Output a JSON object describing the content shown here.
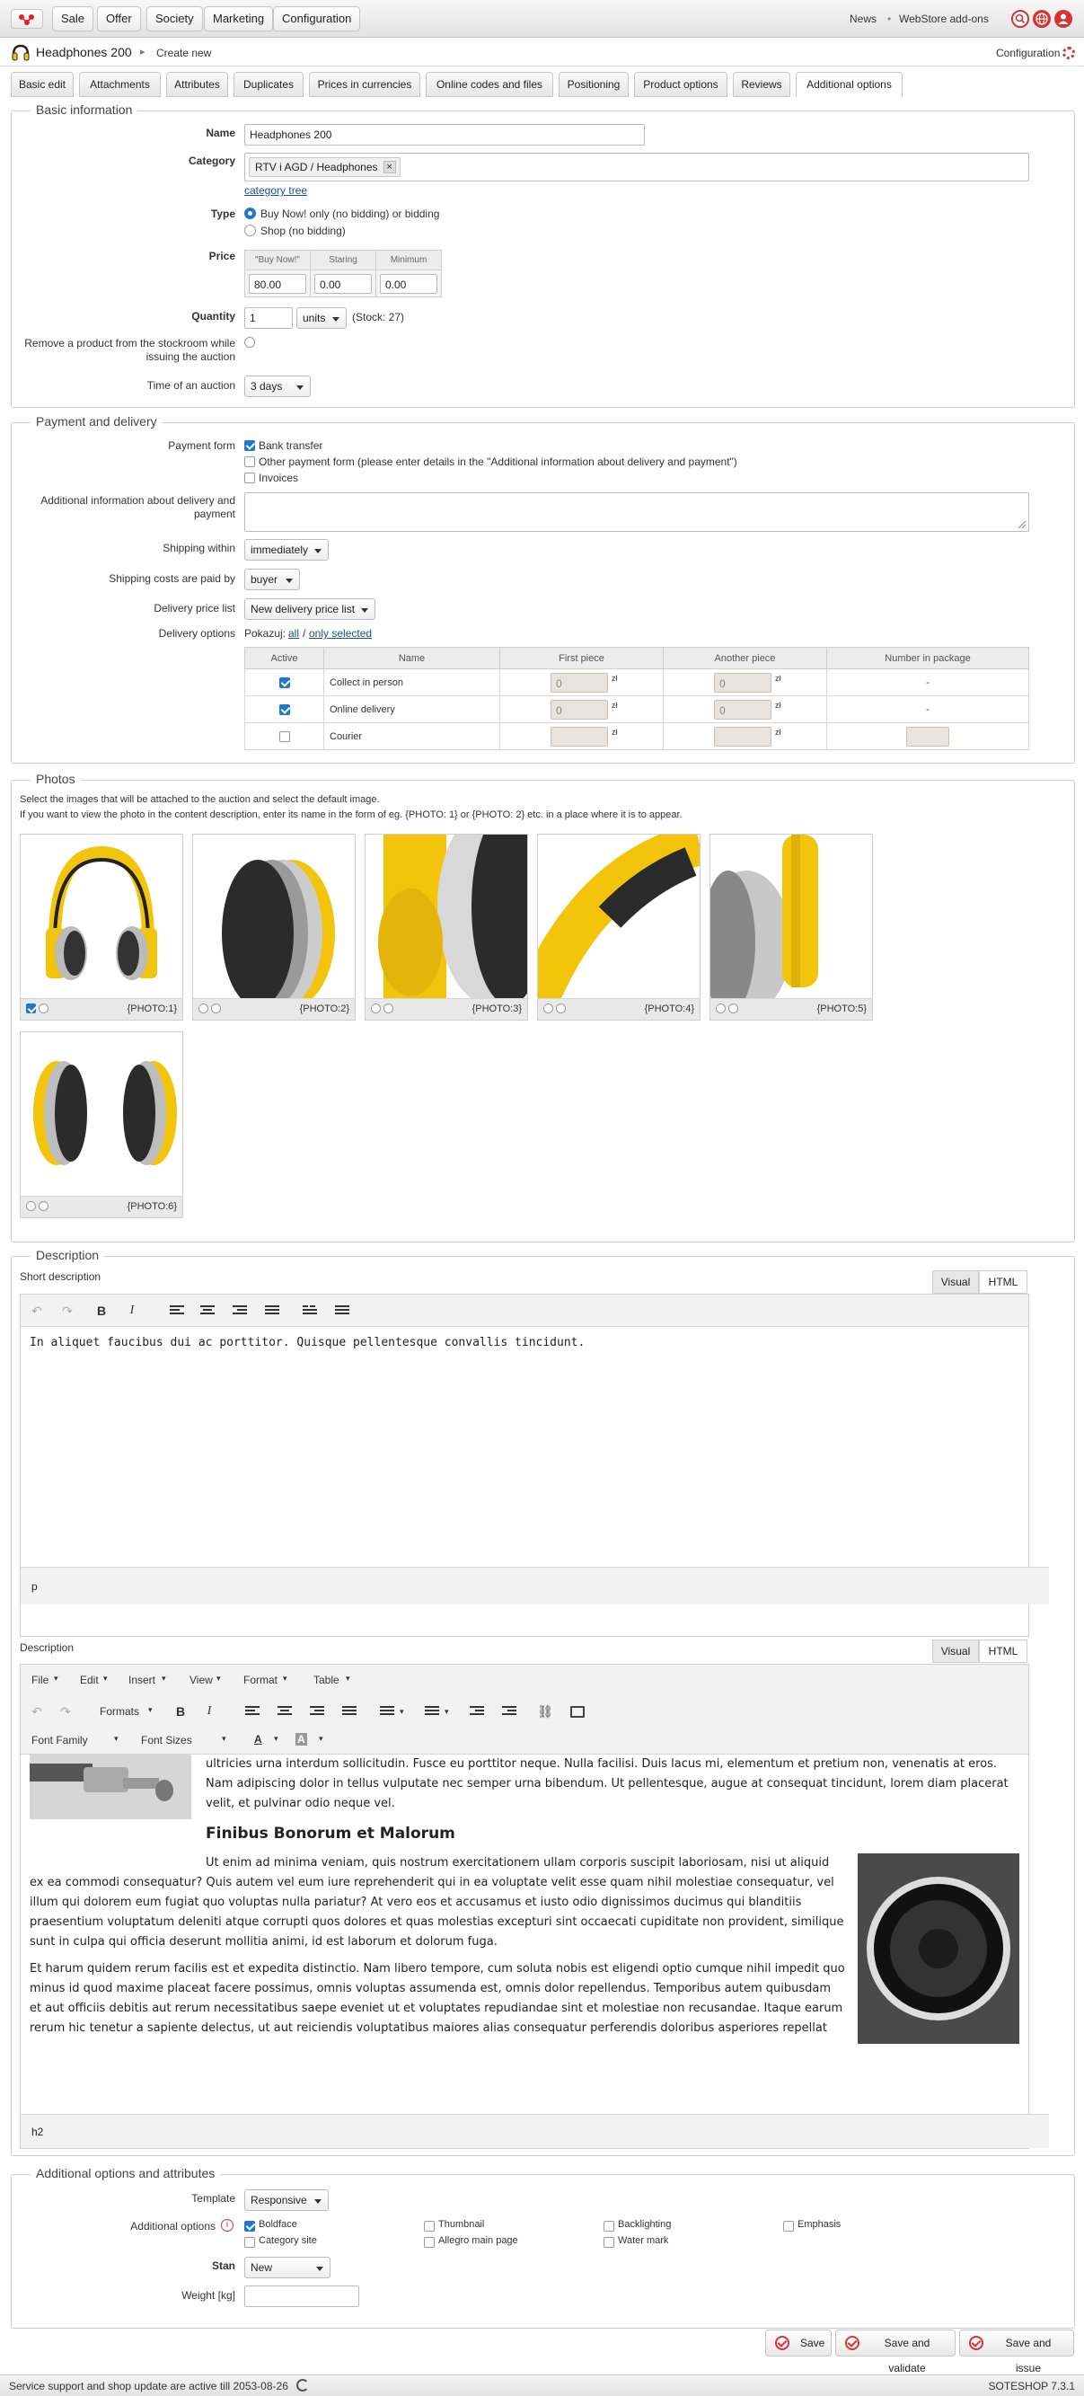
{
  "topbar": {
    "nav": [
      "Sale",
      "Offer",
      "Society",
      "Marketing",
      "Configuration"
    ],
    "news": "News",
    "separator": "•",
    "addons": "WebStore add-ons"
  },
  "titlebar": {
    "product": "Headphones 200",
    "sep": "▸",
    "action": "Create new",
    "config": "Configuration"
  },
  "tabs": [
    "Basic edit",
    "Attachments",
    "Attributes",
    "Duplicates",
    "Prices in currencies",
    "Online codes and files",
    "Positioning",
    "Product options",
    "Reviews",
    "Additional options"
  ],
  "basic": {
    "legend": "Basic information",
    "name_label": "Name",
    "name_value": "Headphones 200",
    "category_label": "Category",
    "category_value": "RTV i AGD / Headphones",
    "category_close": "×",
    "category_tree": "category tree",
    "type_label": "Type",
    "type_opt1": "Buy Now! only (no bidding) or bidding",
    "type_opt2": "Shop (no bidding)",
    "price_label": "Price",
    "price_headers": [
      "\"Buy Now!\"",
      "Staring",
      "Minimum"
    ],
    "price_values": [
      "80.00",
      "0.00",
      "0.00"
    ],
    "quantity_label": "Quantity",
    "quantity_value": "1",
    "quantity_unit": "units",
    "stock": "(Stock: 27)",
    "remove_label": "Remove a product from the stockroom while issuing the auction",
    "time_label": "Time of an auction",
    "time_value": "3 days"
  },
  "payment": {
    "legend": "Payment and delivery",
    "form_label": "Payment form",
    "form_opt1": "Bank transfer",
    "form_opt2": "Other payment form (please enter details in the \"Additional information about delivery and payment\")",
    "form_opt3": "Invoices",
    "info_label": "Additional information about delivery and payment",
    "shipping_within_label": "Shipping within",
    "shipping_within_value": "immediately",
    "costs_label": "Shipping costs are paid by",
    "costs_value": "buyer",
    "price_list_label": "Delivery price list",
    "price_list_value": "New delivery price list",
    "options_label": "Delivery options",
    "show_text": "Pokazuj:",
    "show_all": "all",
    "show_slash": "/",
    "show_selected": "only selected",
    "table_headers": [
      "Active",
      "Name",
      "First piece",
      "Another piece",
      "Number in package"
    ],
    "rows": [
      {
        "name": "Collect in person",
        "first": "0",
        "another": "0",
        "pkg": "-",
        "currency": "zł"
      },
      {
        "name": "Online delivery",
        "first": "0",
        "another": "0",
        "pkg": "-",
        "currency": "zł"
      },
      {
        "name": "Courier",
        "first": "",
        "another": "",
        "pkg": "",
        "currency": "zł"
      }
    ]
  },
  "photos": {
    "legend": "Photos",
    "hint1": "Select the images that will be attached to the auction and select the default image.",
    "hint2": "If you want to view the photo in the content description, enter its name in the form of eg. {PHOTO: 1} or {PHOTO: 2} etc. in a place where it is to appear.",
    "tags": [
      "{PHOTO:1}",
      "{PHOTO:2}",
      "{PHOTO:3}",
      "{PHOTO:4}",
      "{PHOTO:5}",
      "{PHOTO:6}"
    ]
  },
  "description": {
    "legend": "Description",
    "short_label": "Short description",
    "tab_visual": "Visual",
    "tab_html": "HTML",
    "short_text": "In aliquet faucibus dui ac porttitor. Quisque pellentesque convallis tincidunt.",
    "short_status": "p",
    "desc_label": "Description",
    "menu": [
      "File",
      "Edit",
      "Insert",
      "View",
      "Format",
      "Table"
    ],
    "formats": "Formats",
    "font_family": "Font Family",
    "font_sizes": "Font Sizes",
    "font_color": "A",
    "bg_color": "A",
    "para1": "ultricies urna interdum sollicitudin. Fusce eu porttitor neque. Nulla facilisi. Duis lacus mi, elementum et pretium non, venenatis at eros. Nam adipiscing dolor in tellus vulputate nec semper urna bibendum. Ut pellentesque, augue at consequat tincidunt, lorem diam placerat velit, et pulvinar odio neque vel.",
    "heading": "Finibus Bonorum et Malorum",
    "para2": "Ut enim ad minima veniam, quis nostrum exercitationem ullam corporis suscipit laboriosam, nisi ut aliquid ex ea commodi consequatur? Quis autem vel eum iure reprehenderit qui in ea voluptate velit esse quam nihil molestiae consequatur, vel illum qui dolorem eum fugiat quo voluptas nulla pariatur? At vero eos et accusamus et iusto odio dignissimos ducimus qui blanditiis praesentium voluptatum deleniti atque corrupti quos dolores et quas molestias excepturi sint occaecati cupiditate non provident, similique sunt in culpa qui officia deserunt mollitia animi, id est laborum et dolorum fuga.",
    "para3": "Et harum quidem rerum facilis est et expedita distinctio. Nam libero tempore, cum soluta nobis est eligendi optio cumque nihil impedit quo minus id quod maxime placeat facere possimus, omnis voluptas assumenda est, omnis dolor repellendus. Temporibus autem quibusdam et aut officiis debitis aut rerum necessitatibus saepe eveniet ut et voluptates repudiandae sint et molestiae non recusandae. Itaque earum rerum hic tenetur a sapiente delectus, ut aut reiciendis voluptatibus maiores alias consequatur perferendis doloribus asperiores repellat",
    "desc_status": "h2"
  },
  "additional": {
    "legend": "Additional options and attributes",
    "template_label": "Template",
    "template_value": "Responsive",
    "options_label": "Additional options",
    "opts": [
      "Boldface",
      "Thumbnail",
      "Backlighting",
      "Emphasis",
      "Category site",
      "Allegro main page",
      "Water mark"
    ],
    "stan_label": "Stan",
    "stan_value": "New",
    "weight_label": "Weight [kg]"
  },
  "buttons": {
    "save": "Save",
    "validate": "Save and validate",
    "issue": "Save and issue"
  },
  "footer": {
    "support": "Service support and shop update are active till 2053-08-26",
    "version": "SOTESHOP 7.3.1"
  }
}
